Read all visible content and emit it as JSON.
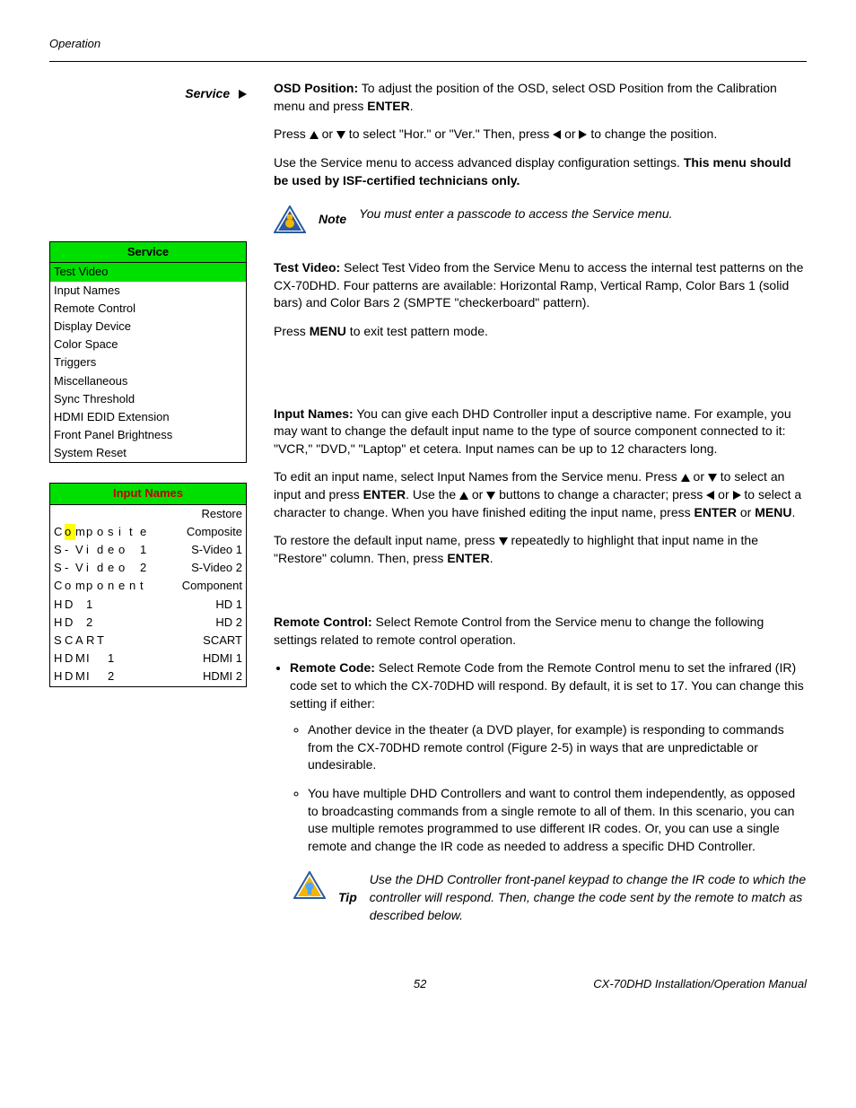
{
  "header": {
    "section": "Operation"
  },
  "footer": {
    "page": "52",
    "title": "CX-70DHD Installation/Operation Manual"
  },
  "sidebar": {
    "service_heading": "Service",
    "service_menu": {
      "title": "Service",
      "items": [
        "Test Video",
        "Input Names",
        "Remote Control",
        "Display Device",
        "Color Space",
        "Triggers",
        "Miscellaneous",
        "Sync Threshold",
        "HDMI EDID Extension",
        "Front Panel Brightness",
        "System Reset"
      ]
    },
    "input_names_menu": {
      "title": "Input Names",
      "restore": "Restore",
      "rows": [
        {
          "label_chars": [
            "C",
            "o",
            "m",
            "p",
            "o",
            "s",
            "i",
            "t",
            "e"
          ],
          "mark_index": 1,
          "right": "Composite"
        },
        {
          "label_chars": [
            "S",
            "-",
            "V",
            "i",
            "d",
            "e",
            "o",
            "",
            "1"
          ],
          "mark_index": -1,
          "right": "S-Video 1"
        },
        {
          "label_chars": [
            "S",
            "-",
            "V",
            "i",
            "d",
            "e",
            "o",
            "",
            "2"
          ],
          "mark_index": -1,
          "right": "S-Video 2"
        },
        {
          "label_chars": [
            "C",
            "o",
            "m",
            "p",
            "o",
            "n",
            "e",
            "n",
            "t"
          ],
          "mark_index": -1,
          "right": "Component"
        },
        {
          "label_chars": [
            "H",
            "D",
            "",
            "1"
          ],
          "mark_index": -1,
          "right": "HD 1"
        },
        {
          "label_chars": [
            "H",
            "D",
            "",
            "2"
          ],
          "mark_index": -1,
          "right": "HD 2"
        },
        {
          "label_chars": [
            "S",
            "C",
            "A",
            "R",
            "T"
          ],
          "mark_index": -1,
          "right": "SCART"
        },
        {
          "label_chars": [
            "H",
            "D",
            "M",
            "I",
            "",
            "1"
          ],
          "mark_index": -1,
          "right": "HDMI 1"
        },
        {
          "label_chars": [
            "H",
            "D",
            "M",
            "I",
            "",
            "2"
          ],
          "mark_index": -1,
          "right": "HDMI 2"
        }
      ]
    }
  },
  "body": {
    "osd_position_label": "OSD Position:",
    "osd_position_text": " To adjust the position of the OSD, select OSD Position from the Calibration menu and press ",
    "enter": "ENTER",
    "osd_press_pre": "Press ",
    "osd_press_mid1": " or ",
    "osd_press_mid2": " to select \"Hor.\" or \"Ver.\" Then, press ",
    "osd_press_mid3": " or ",
    "osd_press_end": " to change the position.",
    "service_intro1": "Use the Service menu to access advanced display configuration settings. ",
    "service_intro_bold": "This menu should be used by ISF-certified technicians only.",
    "note_label": "Note",
    "note_text": "You must enter a passcode to access the Service menu.",
    "test_video_label": "Test Video:",
    "test_video_text": " Select Test Video from the Service Menu to access the internal test patterns on the CX-70DHD. Four patterns are available: Horizontal Ramp, Vertical Ramp, Color Bars 1 (solid bars) and Color Bars 2 (SMPTE \"checkerboard\" pattern).",
    "test_video_exit_pre": "Press ",
    "menu": "MENU",
    "test_video_exit_post": " to exit test pattern mode.",
    "input_names_label": "Input Names:",
    "input_names_p1": " You can give each DHD Controller input a descriptive name. For example, you may want to change the default input name to the type of source component connected to it: \"VCR,\" \"DVD,\" \"Laptop\" et cetera. Input names can be up to 12 characters long.",
    "input_names_p2a": "To edit an input name, select Input Names from the Service menu. Press ",
    "input_names_p2b": " or ",
    "input_names_p2c": " to select an input and press ",
    "input_names_p2d": ". Use the ",
    "input_names_p2e": " or ",
    "input_names_p2f": " buttons to change a character; press ",
    "input_names_p2g": " or ",
    "input_names_p2h": " to select a character to change. When you have finished editing the input name, press ",
    "or_word": " or ",
    "period": ".",
    "input_names_p3a": "To restore the default input name, press ",
    "input_names_p3b": " repeatedly to highlight that input name in the \"Restore\" column. Then, press ",
    "remote_control_label": "Remote Control:",
    "remote_control_text": " Select Remote Control from the Service menu to change the following settings related to remote control operation.",
    "remote_code_label": "Remote Code:",
    "remote_code_text": " Select Remote Code from the Remote Control menu to set the infrared (IR) code set to which the CX-70DHD will respond. By default, it is set to 17. You can change this setting if either:",
    "remote_sub1": "Another device in the theater (a DVD player, for example) is responding to commands from the CX-70DHD remote control (Figure 2-5) in ways that are unpredictable or undesirable.",
    "remote_sub2": "You have multiple DHD Controllers and want to control them independently, as opposed to broadcasting commands from a single remote to all of them. In this scenario, you can use multiple remotes programmed to use different IR codes. Or, you can use a single remote and change the IR code as needed to address a specific DHD Controller.",
    "tip_label": "Tip",
    "tip_text": "Use the DHD Controller front-panel keypad to change the IR code to which the controller will respond. Then, change the code sent by the remote to match as described below."
  }
}
